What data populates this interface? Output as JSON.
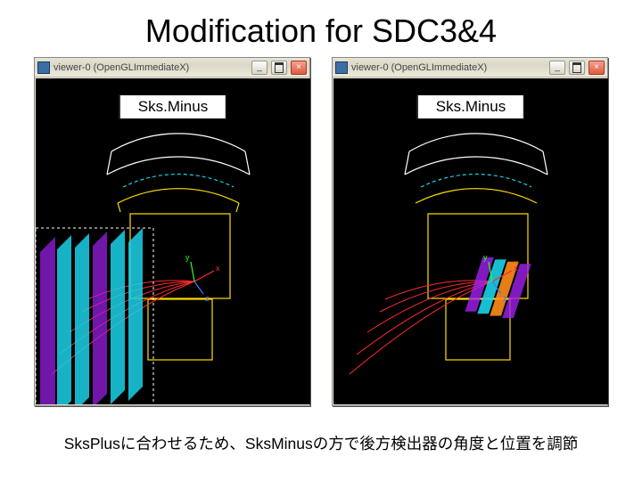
{
  "title": "Modification for SDC3&4",
  "bottom_note": "SksPlusに合わせるため、SksMinusの方で後方検出器の角度と位置を調節",
  "windows": [
    {
      "titlebar": "viewer-0 (OpenGLImmediateX)",
      "label": "Sks.Minus",
      "min_btn": "_",
      "max_btn": "",
      "close_btn": "×"
    },
    {
      "titlebar": "viewer-0 (OpenGLImmediateX)",
      "label": "Sks.Minus",
      "min_btn": "_",
      "max_btn": "",
      "close_btn": "×"
    }
  ],
  "axes": {
    "x": "x",
    "y": "y",
    "z": "z"
  }
}
